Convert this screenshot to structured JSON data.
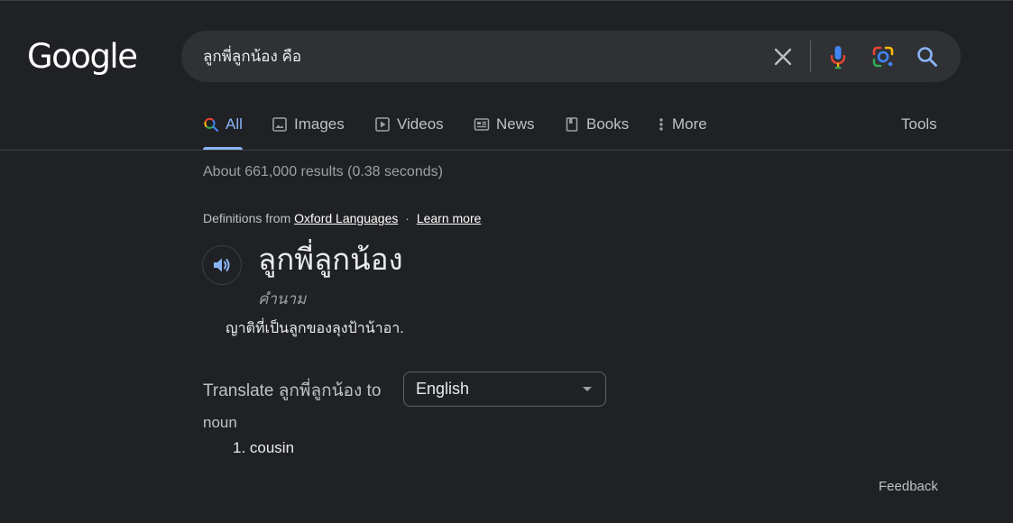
{
  "logo": {
    "text": "Google"
  },
  "search": {
    "query": "ลูกพี่ลูกน้อง คือ"
  },
  "icons": {
    "clear": "close-icon",
    "mic": "microphone-icon",
    "lens": "google-lens-icon",
    "search": "search-icon",
    "speaker": "speaker-icon",
    "dropdown": "caret-down-icon"
  },
  "tabs": [
    {
      "label": "All",
      "icon": "search-icon",
      "active": true
    },
    {
      "label": "Images",
      "icon": "image-icon"
    },
    {
      "label": "Videos",
      "icon": "play-icon"
    },
    {
      "label": "News",
      "icon": "newspaper-icon"
    },
    {
      "label": "Books",
      "icon": "book-icon"
    },
    {
      "label": "More",
      "icon": "kebab-icon"
    }
  ],
  "tools_label": "Tools",
  "results_stats": "About 661,000 results (0.38 seconds)",
  "definition_box": {
    "source_prefix": "Definitions from",
    "source_link": "Oxford Languages",
    "separator": "·",
    "learn_more": "Learn more",
    "word": "ลูกพี่ลูกน้อง",
    "part_of_speech": "คำนาม",
    "definition": "ญาติที่เป็นลูกของลุงป้าน้าอา."
  },
  "translation": {
    "label": "Translate ลูกพี่ลูกน้อง to",
    "language": "English",
    "part_of_speech": "noun",
    "items": [
      "1. cousin"
    ]
  },
  "feedback_label": "Feedback",
  "colors": {
    "background": "#202124",
    "search_box": "#303134",
    "link_blue": "#8ab4f8",
    "text_primary": "#e8eaed",
    "text_secondary": "#9aa0a6"
  }
}
